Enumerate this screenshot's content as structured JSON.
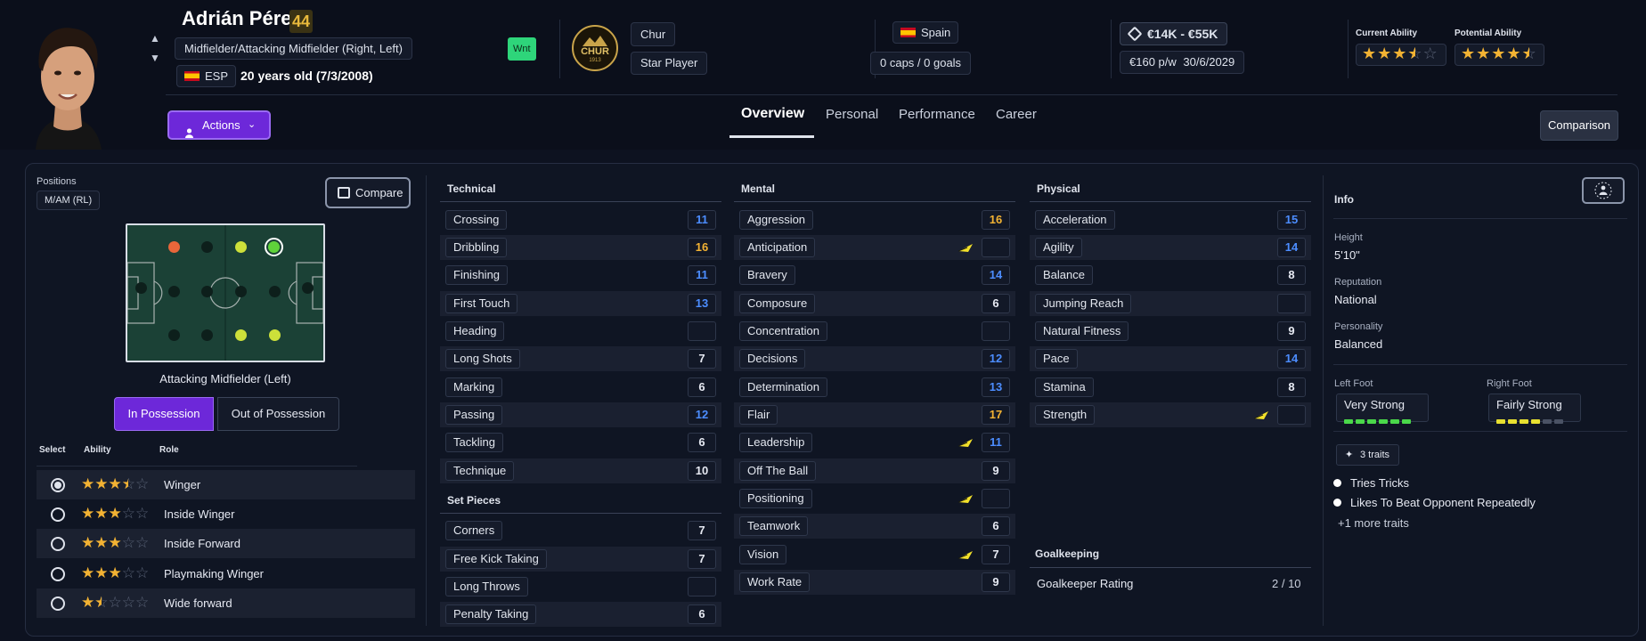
{
  "player": {
    "name": "Adrián Pérez",
    "current_ability_number": "44",
    "position_text": "Midfielder/Attacking Midfielder (Right, Left)",
    "nationality_code": "ESP",
    "age_text": "20 years old (7/3/2008)",
    "status_badge": "Wnt"
  },
  "club": {
    "logo_text": "CHUR",
    "logo_year": "1913",
    "name": "Chur",
    "role": "Star Player"
  },
  "nation": {
    "name": "Spain",
    "caps_goals": "0 caps / 0 goals"
  },
  "contract": {
    "value_range": "€14K - €55K",
    "wage": "€160 p/w",
    "expiry": "30/6/2029"
  },
  "ability": {
    "current_label": "Current Ability",
    "current_stars": 3.5,
    "potential_label": "Potential Ability",
    "potential_stars": 4.5
  },
  "actions_label": "Actions",
  "tabs": [
    "Overview",
    "Personal",
    "Performance",
    "Career"
  ],
  "comparison_label": "Comparison",
  "positions_panel": {
    "label": "Positions",
    "position_chip": "M/AM (RL)",
    "compare_label": "Compare",
    "selected_position_name": "Attacking Midfielder (Left)",
    "in_possession_label": "In Possession",
    "out_of_possession_label": "Out of Possession",
    "col_select": "Select",
    "col_ability": "Ability",
    "col_role": "Role",
    "roles": [
      {
        "name": "Winger",
        "stars": 3.5,
        "selected": true
      },
      {
        "name": "Inside Winger",
        "stars": 3,
        "selected": false
      },
      {
        "name": "Inside Forward",
        "stars": 3,
        "selected": false
      },
      {
        "name": "Playmaking Winger",
        "stars": 3,
        "selected": false
      },
      {
        "name": "Wide forward",
        "stars": 1.5,
        "selected": false
      }
    ]
  },
  "technical": {
    "heading": "Technical",
    "items": [
      {
        "name": "Crossing",
        "value": "11",
        "color": "blue"
      },
      {
        "name": "Dribbling",
        "value": "16",
        "color": "yellow"
      },
      {
        "name": "Finishing",
        "value": "11",
        "color": "blue"
      },
      {
        "name": "First Touch",
        "value": "13",
        "color": "blue"
      },
      {
        "name": "Heading",
        "value": "",
        "color": "white"
      },
      {
        "name": "Long Shots",
        "value": "7",
        "color": "white"
      },
      {
        "name": "Marking",
        "value": "6",
        "color": "white"
      },
      {
        "name": "Passing",
        "value": "12",
        "color": "blue"
      },
      {
        "name": "Tackling",
        "value": "6",
        "color": "white"
      },
      {
        "name": "Technique",
        "value": "10",
        "color": "white"
      }
    ]
  },
  "set_pieces": {
    "heading": "Set Pieces",
    "items": [
      {
        "name": "Corners",
        "value": "7",
        "color": "white"
      },
      {
        "name": "Free Kick Taking",
        "value": "7",
        "color": "white"
      },
      {
        "name": "Long Throws",
        "value": "",
        "color": "white"
      },
      {
        "name": "Penalty Taking",
        "value": "6",
        "color": "white"
      }
    ]
  },
  "mental": {
    "heading": "Mental",
    "items": [
      {
        "name": "Aggression",
        "value": "16",
        "color": "yellow",
        "arrow": false
      },
      {
        "name": "Anticipation",
        "value": "",
        "color": "white",
        "arrow": true
      },
      {
        "name": "Bravery",
        "value": "14",
        "color": "blue",
        "arrow": false
      },
      {
        "name": "Composure",
        "value": "6",
        "color": "white",
        "arrow": false
      },
      {
        "name": "Concentration",
        "value": "",
        "color": "white",
        "arrow": false
      },
      {
        "name": "Decisions",
        "value": "12",
        "color": "blue",
        "arrow": false
      },
      {
        "name": "Determination",
        "value": "13",
        "color": "blue",
        "arrow": false
      },
      {
        "name": "Flair",
        "value": "17",
        "color": "yellow",
        "arrow": false
      },
      {
        "name": "Leadership",
        "value": "11",
        "color": "blue",
        "arrow": true
      },
      {
        "name": "Off The Ball",
        "value": "9",
        "color": "white",
        "arrow": false
      },
      {
        "name": "Positioning",
        "value": "",
        "color": "white",
        "arrow": true
      },
      {
        "name": "Teamwork",
        "value": "6",
        "color": "white",
        "arrow": false
      },
      {
        "name": "Vision",
        "value": "7",
        "color": "white",
        "arrow": true
      },
      {
        "name": "Work Rate",
        "value": "9",
        "color": "white",
        "arrow": false
      }
    ]
  },
  "physical": {
    "heading": "Physical",
    "items": [
      {
        "name": "Acceleration",
        "value": "15",
        "color": "blue",
        "arrow": false
      },
      {
        "name": "Agility",
        "value": "14",
        "color": "blue",
        "arrow": false
      },
      {
        "name": "Balance",
        "value": "8",
        "color": "white",
        "arrow": false
      },
      {
        "name": "Jumping Reach",
        "value": "",
        "color": "white",
        "arrow": false
      },
      {
        "name": "Natural Fitness",
        "value": "9",
        "color": "white",
        "arrow": false
      },
      {
        "name": "Pace",
        "value": "14",
        "color": "blue",
        "arrow": false
      },
      {
        "name": "Stamina",
        "value": "8",
        "color": "white",
        "arrow": false
      },
      {
        "name": "Strength",
        "value": "",
        "color": "white",
        "arrow": true
      }
    ]
  },
  "goalkeeping": {
    "heading": "Goalkeeping",
    "rating_label": "Goalkeeper Rating",
    "rating_value": "2 / 10"
  },
  "info": {
    "heading": "Info",
    "height_label": "Height",
    "height_value": "5'10\"",
    "reputation_label": "Reputation",
    "reputation_value": "National",
    "personality_label": "Personality",
    "personality_value": "Balanced",
    "left_foot_label": "Left Foot",
    "left_foot_value": "Very Strong",
    "left_foot_level": 6,
    "right_foot_label": "Right Foot",
    "right_foot_value": "Fairly Strong",
    "right_foot_level": 4,
    "traits_button": "3 traits",
    "traits": [
      "Tries Tricks",
      "Likes To Beat Opponent Repeatedly"
    ],
    "more_traits": "+1 more traits"
  },
  "colors": {
    "accent_purple": "#7a2ee6",
    "blue_value": "#4c8dff",
    "yellow_value": "#f2b233",
    "star": "#f2b233",
    "left_foot_bar": "#4ad84a",
    "right_foot_bar": "#e8e030",
    "wnt_badge": "#2ed57a"
  }
}
